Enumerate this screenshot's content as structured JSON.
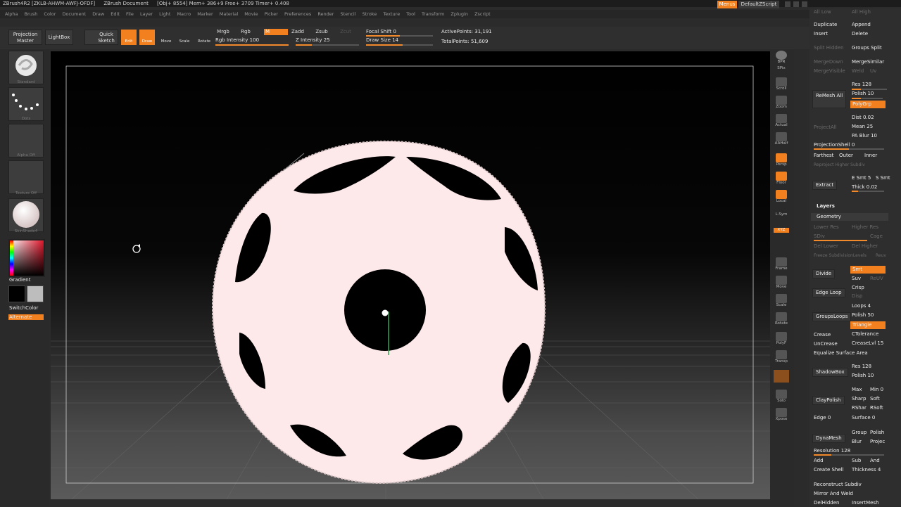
{
  "titlebar": {
    "items": [
      "ZBrush4R2 [ZKLB-AHWM-AWFJ-OFDF]",
      "ZBrush Document",
      "[Obj+ 8554] Mem+ 386+9 Free+ 3709 Timer+ 0.408"
    ],
    "menus_btn": "Menus",
    "script_btn": "DefaultZScript"
  },
  "menubar": [
    "Alpha",
    "Brush",
    "Color",
    "Document",
    "Draw",
    "Edit",
    "File",
    "Layer",
    "Light",
    "Macro",
    "Marker",
    "Material",
    "Movie",
    "Picker",
    "Preferences",
    "Render",
    "Stencil",
    "Stroke",
    "Texture",
    "Tool",
    "Transform",
    "Zplugin",
    "Zscript"
  ],
  "toolbar": {
    "projection_master": "Projection Master",
    "lightbox": "LightBox",
    "quick_sketch": "Quick Sketch",
    "edit": "Edit",
    "draw": "Draw",
    "move": "Move",
    "scale": "Scale",
    "rotate": "Rotate",
    "mrgb": "Mrgb",
    "rgb": "Rgb",
    "m": "M",
    "zadd": "Zadd",
    "zsub": "Zsub",
    "zcut": "Zcut",
    "rgb_intensity": "Rgb Intensity 100",
    "rgb_intensity_value": 100,
    "z_intensity": "Z Intensity 25",
    "z_intensity_value": 25,
    "focal_shift": "Focal Shift 0",
    "focal_shift_value": 0,
    "draw_size": "Draw Size 14",
    "draw_size_value": 14,
    "active_points": "ActivePoints: 31,191",
    "total_points": "TotalPoints: 51,609"
  },
  "leftshelf": {
    "brush": "Standard",
    "stroke": "Dots",
    "alpha": "Alpha Off",
    "texture": "Texture Off",
    "material": "SkinShade4",
    "gradient": "Gradient",
    "switchcolor": "SwitchColor",
    "alternate": "Alternate"
  },
  "rightshelf": [
    "BPR",
    "SPix",
    "Scroll",
    "Zoom",
    "Actual",
    "AAHalf",
    "Persp",
    "Floor",
    "Local",
    "L.Sym",
    "XYZ",
    "Frame",
    "Move",
    "Scale",
    "Rotate",
    "PolyF",
    "Transp",
    "Solo",
    "Xpose"
  ],
  "panel": {
    "top": {
      "all_low": "All Low",
      "all_high": "All High",
      "duplicate": "Duplicate",
      "append": "Append",
      "insert": "Insert",
      "delete": "Delete",
      "split_hidden": "Split Hidden",
      "groups_split": "Groups Split",
      "merge_down": "MergeDown",
      "merge_similar": "MergeSimilar",
      "merge_visible": "MergeVisible",
      "weld": "Weld",
      "uv": "Uv"
    },
    "remesh": {
      "label": "ReMesh All",
      "res": "Res 128",
      "polish": "Polish 10",
      "polygrp": "PolyGrp",
      "project_all": "ProjectAll",
      "dist": "Dist 0.02",
      "mean": "Mean 25",
      "pa_blur": "PA Blur 10",
      "projection_shell": "ProjectionShell 0",
      "farthest": "Farthest",
      "outer": "Outer",
      "inner": "Inner",
      "reproject": "Reproject Higher Subdiv"
    },
    "extract": {
      "label": "Extract",
      "e_smt": "E Smt 5",
      "s_smt": "S Smt",
      "thick": "Thick 0.02"
    },
    "layers": "Layers",
    "geometry": {
      "title": "Geometry",
      "lower_res": "Lower Res",
      "higher_res": "Higher Res",
      "sdiv": "SDiv",
      "cage": "Cage",
      "rstr": "Rstr",
      "del_lower": "Del Lower",
      "del_higher": "Del Higher",
      "freeze": "Freeze SubdivisionLevels",
      "reuv": "Reuv",
      "divide": "Divide",
      "smt": "Smt",
      "suv": "Suv",
      "reuv2": "ReUV",
      "edge_loop": "Edge Loop",
      "crisp": "Crisp",
      "disp": "Disp",
      "groups_loops": "GroupsLoops",
      "loops": "Loops 4",
      "polish": "Polish 50",
      "triangle": "Triangle",
      "crease": "Crease",
      "uncrease": "UnCrease",
      "ctolerance": "CTolerance",
      "creaselvl": "CreaseLvl 15",
      "equalize": "Equalize Surface Area",
      "shadowbox": "ShadowBox",
      "sb_res": "Res 128",
      "sb_polish": "Polish 10",
      "claypolish": "ClayPolish",
      "max": "Max",
      "min": "Min 0",
      "sharp": "Sharp",
      "soft": "Soft",
      "rsharp": "RShar",
      "rsoft": "RSoft",
      "edge": "Edge 0",
      "surface": "Surface 0",
      "dynamesh": "DynaMesh",
      "group": "Group",
      "dm_polish": "Polish",
      "blur": "Blur",
      "project": "Projec",
      "resolution": "Resolution 128",
      "add": "Add",
      "sub": "Sub",
      "and": "And",
      "create_shell": "Create Shell",
      "thickness": "Thickness 4",
      "reconstruct": "Reconstruct Subdiv",
      "mirror_weld": "Mirror And Weld",
      "delhidden": "DelHidden",
      "insertmesh": "InsertMesh"
    }
  },
  "colors": {
    "accent": "#f2801f",
    "bg": "#2b2b2b"
  }
}
